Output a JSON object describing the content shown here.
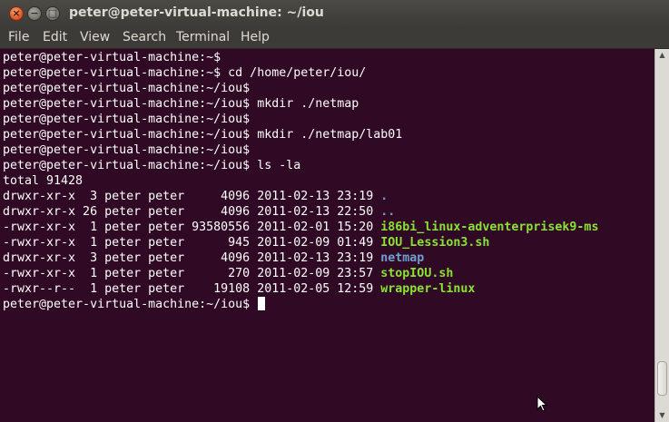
{
  "window": {
    "title": "peter@peter-virtual-machine: ~/iou",
    "close_glyph": "×",
    "minimize_glyph": "−",
    "maximize_glyph": "□"
  },
  "menubar": {
    "items": [
      "File",
      "Edit",
      "View",
      "Search",
      "Terminal",
      "Help"
    ]
  },
  "terminal": {
    "lines": [
      [
        {
          "t": "peter@peter-virtual-machine:~$ ",
          "c": ""
        }
      ],
      [
        {
          "t": "peter@peter-virtual-machine:~$ cd /home/peter/iou/",
          "c": ""
        }
      ],
      [
        {
          "t": "peter@peter-virtual-machine:~/iou$ ",
          "c": ""
        }
      ],
      [
        {
          "t": "peter@peter-virtual-machine:~/iou$ mkdir ./netmap",
          "c": ""
        }
      ],
      [
        {
          "t": "peter@peter-virtual-machine:~/iou$ ",
          "c": ""
        }
      ],
      [
        {
          "t": "peter@peter-virtual-machine:~/iou$ mkdir ./netmap/lab01",
          "c": ""
        }
      ],
      [
        {
          "t": "peter@peter-virtual-machine:~/iou$ ",
          "c": ""
        }
      ],
      [
        {
          "t": "peter@peter-virtual-machine:~/iou$ ls -la",
          "c": ""
        }
      ],
      [
        {
          "t": "total 91428",
          "c": ""
        }
      ],
      [
        {
          "t": "drwxr-xr-x  3 peter peter     4096 2011-02-13 23:19 ",
          "c": ""
        },
        {
          "t": ".",
          "c": "dir"
        }
      ],
      [
        {
          "t": "drwxr-xr-x 26 peter peter     4096 2011-02-13 22:50 ",
          "c": ""
        },
        {
          "t": "..",
          "c": "dir"
        }
      ],
      [
        {
          "t": "-rwxr-xr-x  1 peter peter 93580556 2011-02-01 15:20 ",
          "c": ""
        },
        {
          "t": "i86bi_linux-adventerprisek9-ms",
          "c": "exec"
        }
      ],
      [
        {
          "t": "-rwxr-xr-x  1 peter peter      945 2011-02-09 01:49 ",
          "c": ""
        },
        {
          "t": "IOU_Lession3.sh",
          "c": "exec"
        }
      ],
      [
        {
          "t": "drwxr-xr-x  3 peter peter     4096 2011-02-13 23:19 ",
          "c": ""
        },
        {
          "t": "netmap",
          "c": "dir"
        }
      ],
      [
        {
          "t": "-rwxr-xr-x  1 peter peter      270 2011-02-09 23:57 ",
          "c": ""
        },
        {
          "t": "stopIOU.sh",
          "c": "exec"
        }
      ],
      [
        {
          "t": "-rwxr--r--  1 peter peter    19108 2011-02-05 12:59 ",
          "c": ""
        },
        {
          "t": "wrapper-linux",
          "c": "exec"
        }
      ],
      [
        {
          "t": "peter@peter-virtual-machine:~/iou$ ",
          "c": ""
        }
      ]
    ]
  },
  "scrollbar": {
    "up_glyph": "▲",
    "down_glyph": "▼",
    "position": 1.0
  },
  "colors": {
    "background": "#300a24",
    "foreground": "#ffffff",
    "directory": "#729fcf",
    "executable": "#8ae234"
  }
}
